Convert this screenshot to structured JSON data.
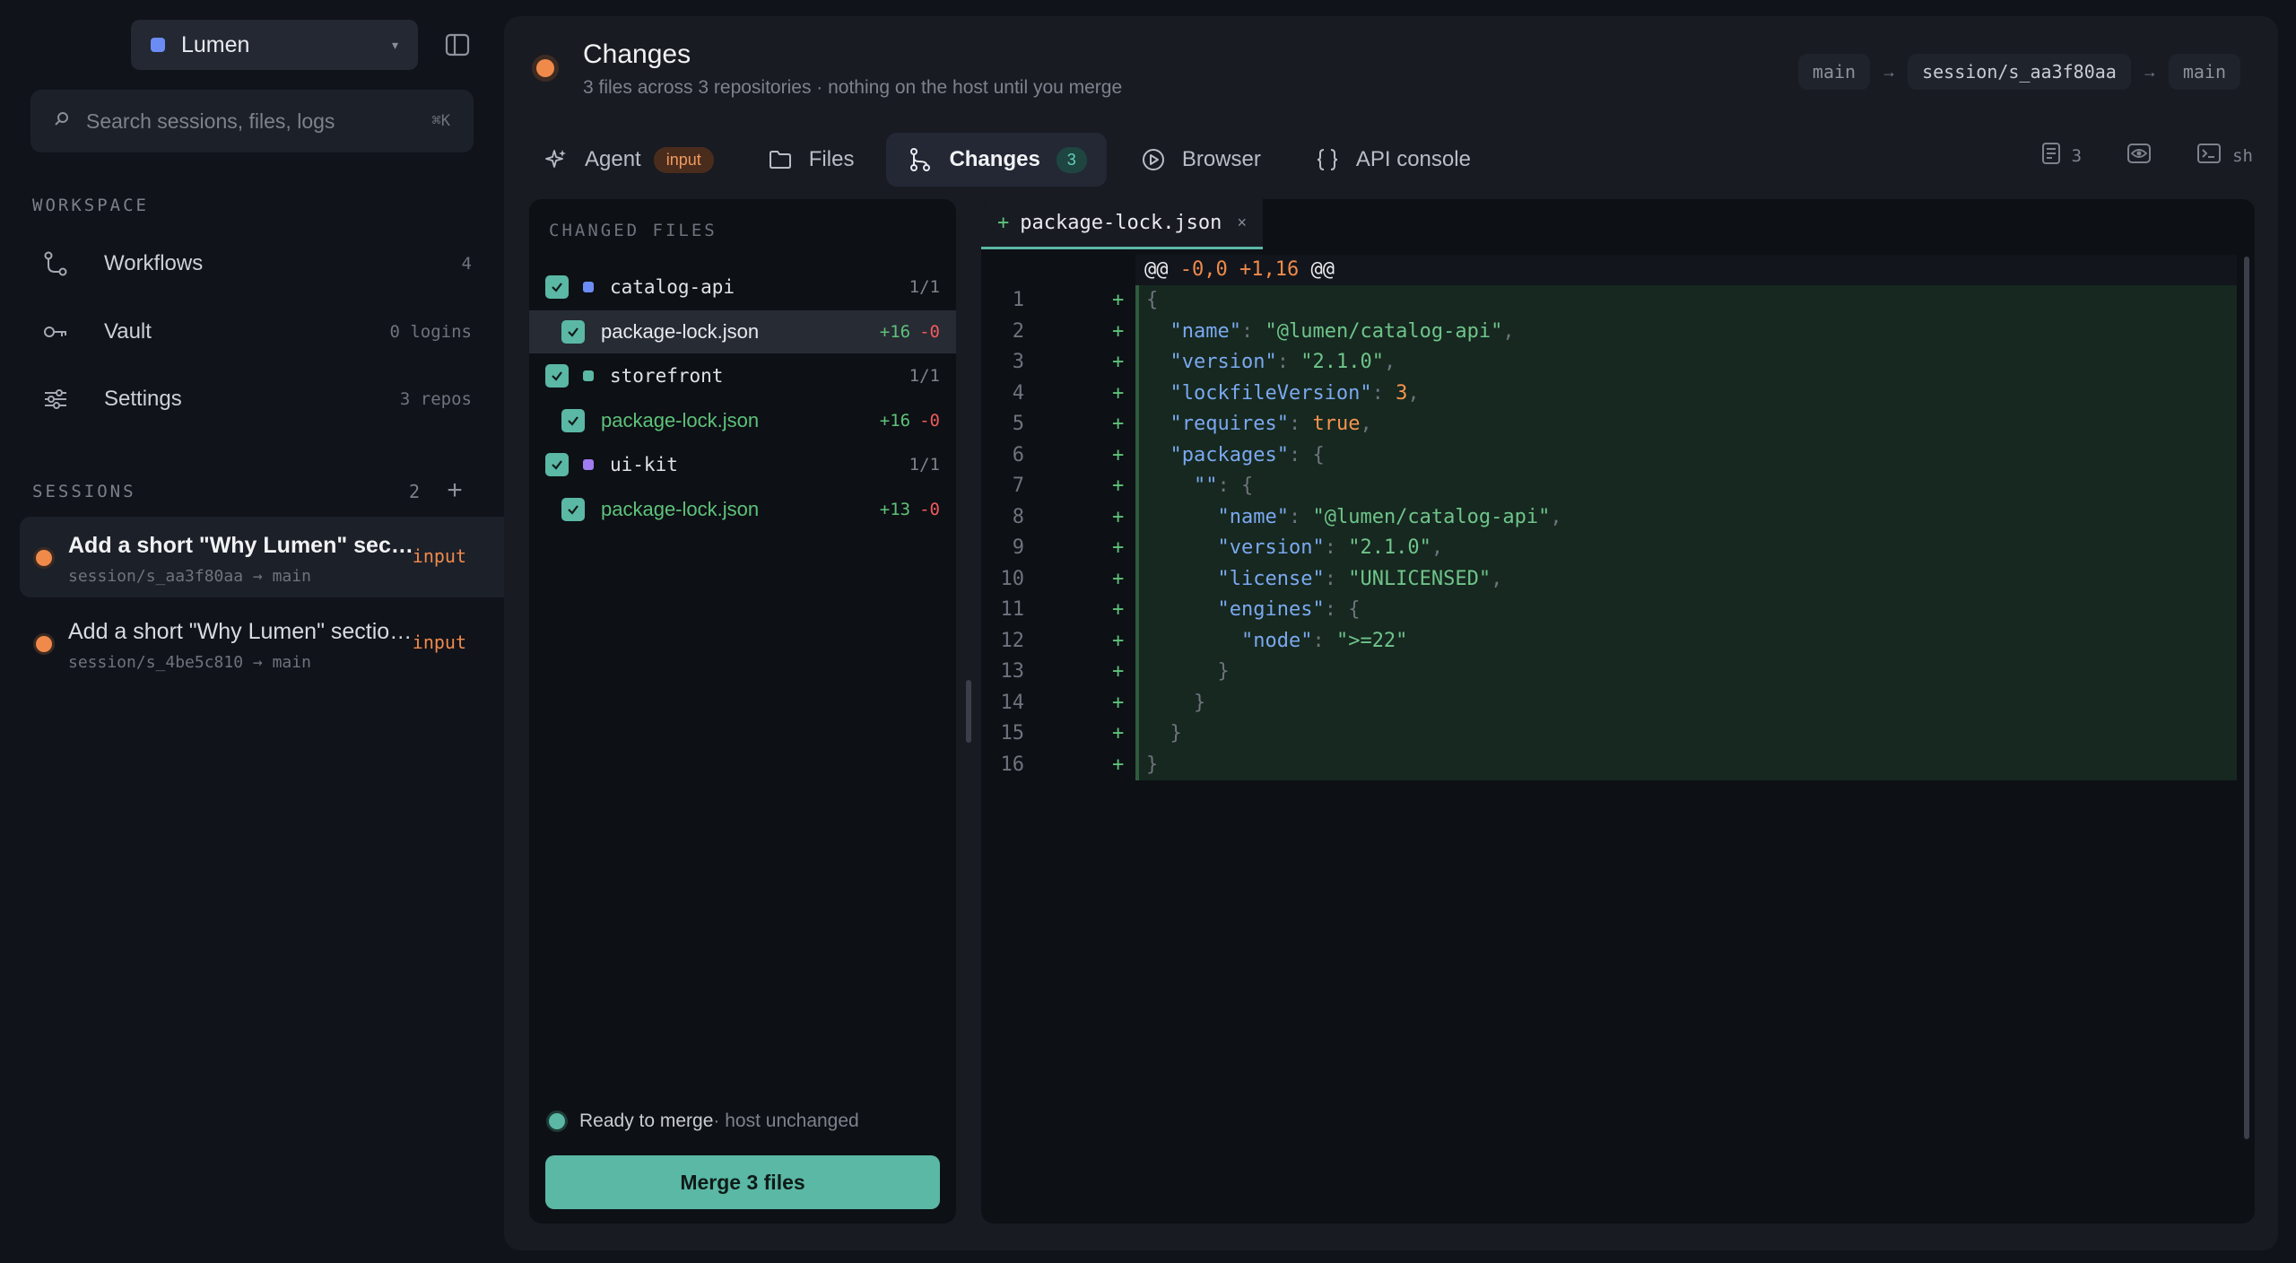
{
  "workspace": {
    "name": "Lumen"
  },
  "search": {
    "placeholder": "Search sessions, files, logs",
    "shortcut": "⌘K"
  },
  "sidebar": {
    "workspace_label": "WORKSPACE",
    "items": [
      {
        "label": "Workflows",
        "meta": "4",
        "icon": "workflow-icon"
      },
      {
        "label": "Vault",
        "meta": "0 logins",
        "icon": "key-icon"
      },
      {
        "label": "Settings",
        "meta": "3 repos",
        "icon": "sliders-icon"
      }
    ],
    "sessions_label": "SESSIONS",
    "sessions_count": "2",
    "sessions": [
      {
        "title": "Add a short \"Why Lumen\" section to the README",
        "sub": "session/s_aa3f80aa → main",
        "badge": "input"
      },
      {
        "title": "Add a short \"Why Lumen\" section to the README",
        "sub": "session/s_4be5c810 → main",
        "badge": "input"
      }
    ]
  },
  "header": {
    "title": "Changes",
    "subtitle": "3 files across 3 repositories · nothing on the host until you merge",
    "branches": [
      "main",
      "session/s_aa3f80aa",
      "main"
    ],
    "arrow": "→"
  },
  "tabs": [
    {
      "label": "Agent",
      "badge": "input",
      "icon": "sparkle-icon"
    },
    {
      "label": "Files",
      "icon": "folder-icon"
    },
    {
      "label": "Changes",
      "badge": "3",
      "icon": "git-branch-icon"
    },
    {
      "label": "Browser",
      "icon": "play-circle-icon"
    },
    {
      "label": "API console",
      "icon": "braces-icon"
    }
  ],
  "tools": {
    "docs_count": "3",
    "terminal_label": "sh"
  },
  "changed_files": {
    "heading": "CHANGED FILES",
    "repos": [
      {
        "name": "catalog-api",
        "count": "1/1",
        "color": "#6c8cf5",
        "file": "package-lock.json",
        "added": "+16",
        "removed": "-0"
      },
      {
        "name": "storefront",
        "count": "1/1",
        "color": "#5ab8a5",
        "file": "package-lock.json",
        "added": "+16",
        "removed": "-0"
      },
      {
        "name": "ui-kit",
        "count": "1/1",
        "color": "#a07cf0",
        "file": "package-lock.json",
        "added": "+13",
        "removed": "-0"
      }
    ],
    "status_ready": "Ready to merge",
    "status_host": " · host unchanged",
    "merge_label": "Merge 3 files"
  },
  "editor": {
    "tab_file": "package-lock.json",
    "tab_prefix": "+",
    "close": "×",
    "hunk": {
      "at": "@@",
      "old": "-0,0",
      "new": "+1,16"
    },
    "lines": [
      "{",
      "  \"name\": \"@lumen/catalog-api\",",
      "  \"version\": \"2.1.0\",",
      "  \"lockfileVersion\": 3,",
      "  \"requires\": true,",
      "  \"packages\": {",
      "    \"\": {",
      "      \"name\": \"@lumen/catalog-api\",",
      "      \"version\": \"2.1.0\",",
      "      \"license\": \"UNLICENSED\",",
      "      \"engines\": {",
      "        \"node\": \">=22\"",
      "      }",
      "    }",
      "  }",
      "}"
    ]
  },
  "colors": {
    "accent": "#5ab8a5",
    "warning": "#f08a4b",
    "added": "#5ec27a",
    "removed": "#ef5b5b"
  }
}
